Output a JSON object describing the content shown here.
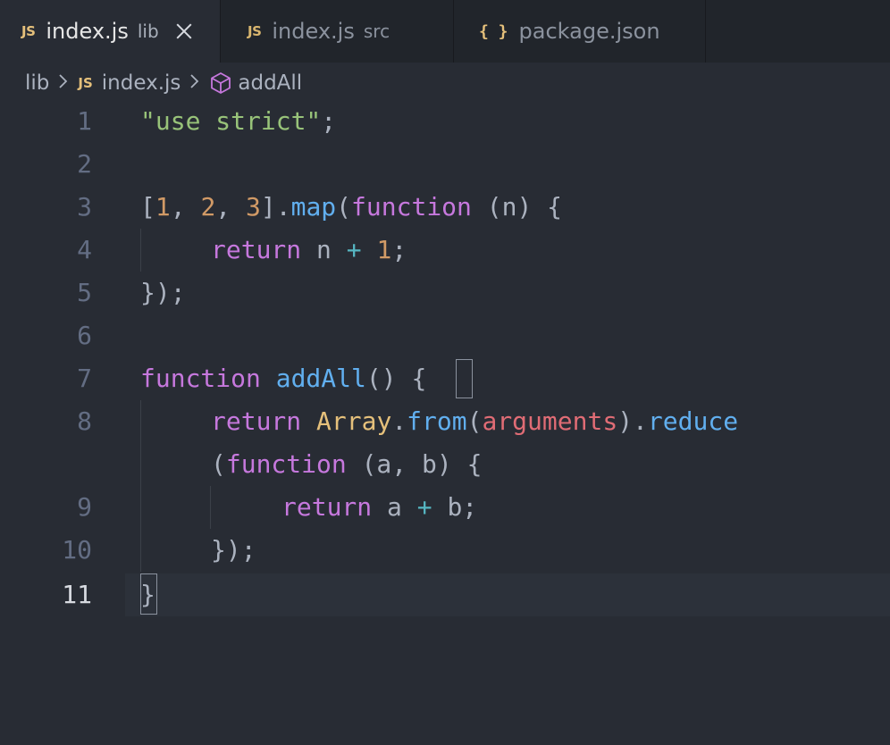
{
  "tabs": [
    {
      "icon": "JS",
      "label": "index.js",
      "description": "lib",
      "active": true
    },
    {
      "icon": "JS",
      "label": "index.js",
      "description": "src",
      "active": false
    },
    {
      "icon": "{ }",
      "label": "package.json",
      "description": "",
      "active": false
    }
  ],
  "breadcrumb": {
    "folder": "lib",
    "file_icon": "JS",
    "file": "index.js",
    "symbol": "addAll"
  },
  "lines": [
    {
      "number": "1"
    },
    {
      "number": "2"
    },
    {
      "number": "3"
    },
    {
      "number": "4"
    },
    {
      "number": "5"
    },
    {
      "number": "6"
    },
    {
      "number": "7"
    },
    {
      "number": "8"
    },
    {
      "number": "9"
    },
    {
      "number": "10"
    },
    {
      "number": "11"
    }
  ],
  "code": {
    "l1": {
      "str": "\"use strict\"",
      "semi": ";"
    },
    "l3": {
      "open": "[",
      "n1": "1",
      "c1": ", ",
      "n2": "2",
      "c2": ", ",
      "n3": "3",
      "close": "].",
      "map": "map",
      "paren": "(",
      "kw": "function",
      "args": " (n) {"
    },
    "l4": {
      "kw": "return",
      "var": " n ",
      "op": "+",
      "sp": " ",
      "num": "1",
      "semi": ";"
    },
    "l5": {
      "text": "});"
    },
    "l7": {
      "kw": "function",
      "sp": " ",
      "name": "addAll",
      "parens": "() ",
      "brace": "{"
    },
    "l8a": {
      "kw": "return",
      "sp": " ",
      "cls": "Array",
      "dot": ".",
      "from": "from",
      "open": "(",
      "args": "arguments",
      "close": ").",
      "reduce": "reduce"
    },
    "l8b": {
      "open": "(",
      "kw": "function",
      "args": " (a, b) {"
    },
    "l9": {
      "kw": "return",
      "var": " a ",
      "op": "+",
      "rest": " b;"
    },
    "l10": {
      "text": "});"
    },
    "l11": {
      "brace": "}"
    }
  },
  "active_line": "11",
  "icons": [
    "js-file-icon",
    "json-file-icon",
    "close-icon",
    "chevron-right-icon",
    "symbol-method-icon"
  ]
}
